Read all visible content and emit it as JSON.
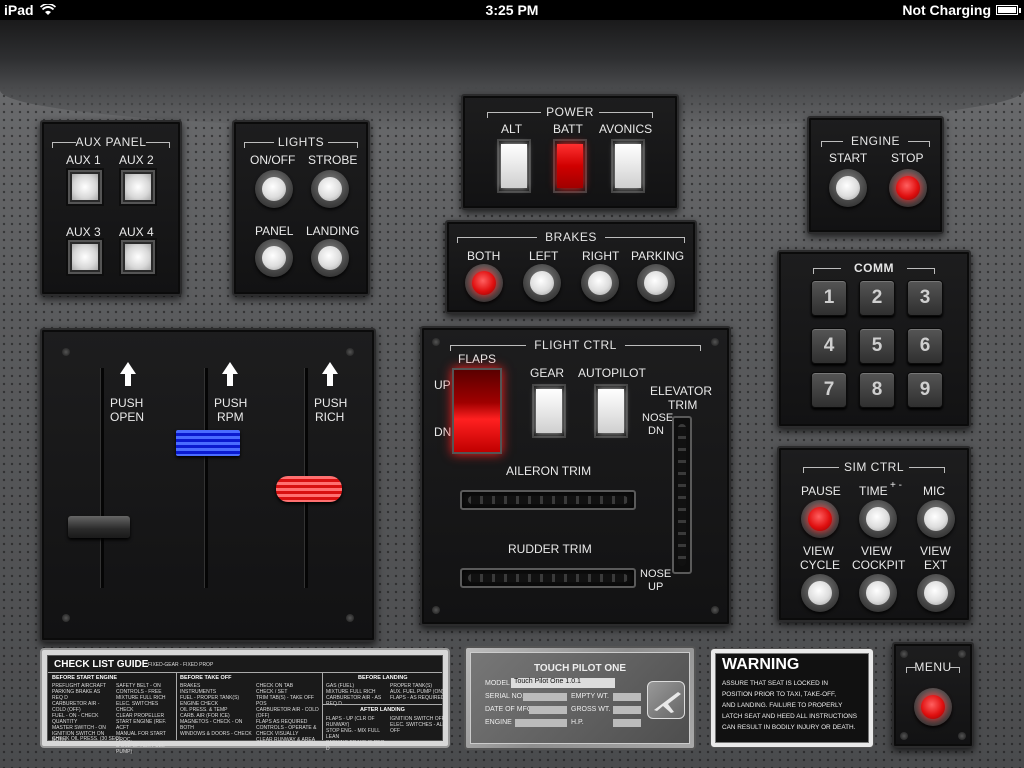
{
  "status": {
    "device": "iPad",
    "time": "3:25 PM",
    "battery": "Not Charging"
  },
  "aux_panel": {
    "title": "AUX PANEL",
    "aux1": "AUX 1",
    "aux2": "AUX 2",
    "aux3": "AUX 3",
    "aux4": "AUX 4"
  },
  "lights": {
    "title": "LIGHTS",
    "onoff": "ON/OFF",
    "strobe": "STROBE",
    "panel": "PANEL",
    "landing": "LANDING"
  },
  "power": {
    "title": "POWER",
    "alt": "ALT",
    "batt": "BATT",
    "avonics": "AVONICS"
  },
  "brakes": {
    "title": "BRAKES",
    "both": "BOTH",
    "left": "LEFT",
    "right": "RIGHT",
    "parking": "PARKING"
  },
  "engine": {
    "title": "ENGINE",
    "start": "START",
    "stop": "STOP"
  },
  "comm": {
    "title": "COMM",
    "keys": [
      "1",
      "2",
      "3",
      "4",
      "5",
      "6",
      "7",
      "8",
      "9"
    ]
  },
  "throttle": {
    "push1": "PUSH",
    "open": "OPEN",
    "push2": "PUSH",
    "rpm": "RPM",
    "push3": "PUSH",
    "rich": "RICH"
  },
  "flight_ctrl": {
    "title": "FLIGHT CTRL",
    "flaps": "FLAPS",
    "up": "UP",
    "dn": "DN",
    "gear": "GEAR",
    "autopilot": "AUTOPILOT",
    "elevator": "ELEVATOR",
    "trim": "TRIM",
    "nose": "NOSE",
    "nose_dn": "DN",
    "nose2": "NOSE",
    "nose_up": "UP",
    "aileron_trim": "AILERON TRIM",
    "rudder_trim": "RUDDER TRIM"
  },
  "sim_ctrl": {
    "title": "SIM CTRL",
    "pause": "PAUSE",
    "time": "TIME",
    "time_pm": "+ -",
    "mic": "MIC",
    "view1": "VIEW",
    "cycle": "CYCLE",
    "view2": "VIEW",
    "cockpit": "COCKPIT",
    "view3": "VIEW",
    "ext": "EXT"
  },
  "checklist": {
    "title": "CHECK LIST GUIDE",
    "subtitle": "FIXED-GEAR - FIXED PROP",
    "before_start": "BEFORE START ENGINE",
    "before_takeoff": "BEFORE TAKE OFF",
    "before_landing": "BEFORE LANDING",
    "after_landing": "AFTER LANDING",
    "c1": [
      "PREFLIGHT AIRCRAFT",
      "PARKING BRAKE  AS REQ D",
      "CARBURETOR AIR - COLD (OFF)",
      "FUEL - ON - CHECK QUANTITY",
      "MASTER SWITCH - ON",
      "IGNITION SWITCH  ON BOTH"
    ],
    "c1b": "CHECK OIL PRESS. (30 SEC)",
    "c2": [
      "SAFETY BELT - ON",
      "CONTROLS - FREE",
      "MIXTURE  FULL RICH",
      "ELEC. SWITCHES  CHECK",
      "CLEAR PROPELLER",
      "START ENGINE (REF. ACFT",
      "MANUAL FOR START PROC.",
      "& USE OF AUX FUEL PUMP)"
    ],
    "c3": [
      "BRAKES",
      "INSTRUMENTS",
      "FUEL - PROPER TANK(S)",
      "ENGINE CHECK",
      "   OIL PRESS. & TEMP",
      "   CARB. AIR (FOR ICE)",
      "   MAGNETOS - CHECK - ON BOTH",
      "WINDOWS & DOORS - CHECK"
    ],
    "c4": [
      "CHECK ON TAB",
      "CHECK  /  SET",
      "TRIM TAB(S) - TAKE OFF POS",
      "CARBURETOR AIR - COLD (OFF)",
      "FLAPS AS REQUIRED",
      "CONTROLS - OPERATE &",
      "   CHECK VISUALLY",
      "CLEAR RUNWAY & AREA"
    ],
    "c5": [
      "GAS (FUEL)",
      "MIXTURE  FULL RICH",
      "CARBURETOR AIR - AS REQ D"
    ],
    "c6": [
      "PROPER TANK(S)",
      "AUX. FUEL PUMP (ON)",
      "FLAPS - AS REQUIRED"
    ],
    "c7": [
      "FLAPS - UP (CLR OF RUNWAY)",
      "STOP ENG. - MIX FULL LEAN",
      "PARKING BRAKE  IF REQ D"
    ],
    "c8": [
      "IGNITION SWITCH  OFF",
      "ELEC. SWITCHES - ALL OFF"
    ]
  },
  "data_plate": {
    "title": "TOUCH PILOT ONE",
    "model_label": "MODEL",
    "model_value": "Touch Pilot One 1.0.1",
    "serial": "SERIAL NO.",
    "empty_wt": "EMPTY WT.",
    "date": "DATE OF MFG.",
    "gross_wt": "GROSS WT.",
    "engine": "ENGINE",
    "hp": "H.P."
  },
  "warning": {
    "title": "WARNING",
    "lines": [
      "ASSURE THAT SEAT IS LOCKED IN",
      "POSITION PRIOR TO TAXI, TAKE-OFF,",
      "AND LANDING.  FAILURE TO PROPERLY",
      "LATCH SEAT AND HEED ALL INSTRUCTIONS",
      "CAN RESULT IN BODILY INJURY OR DEATH."
    ]
  },
  "menu": {
    "label": "MENU"
  }
}
